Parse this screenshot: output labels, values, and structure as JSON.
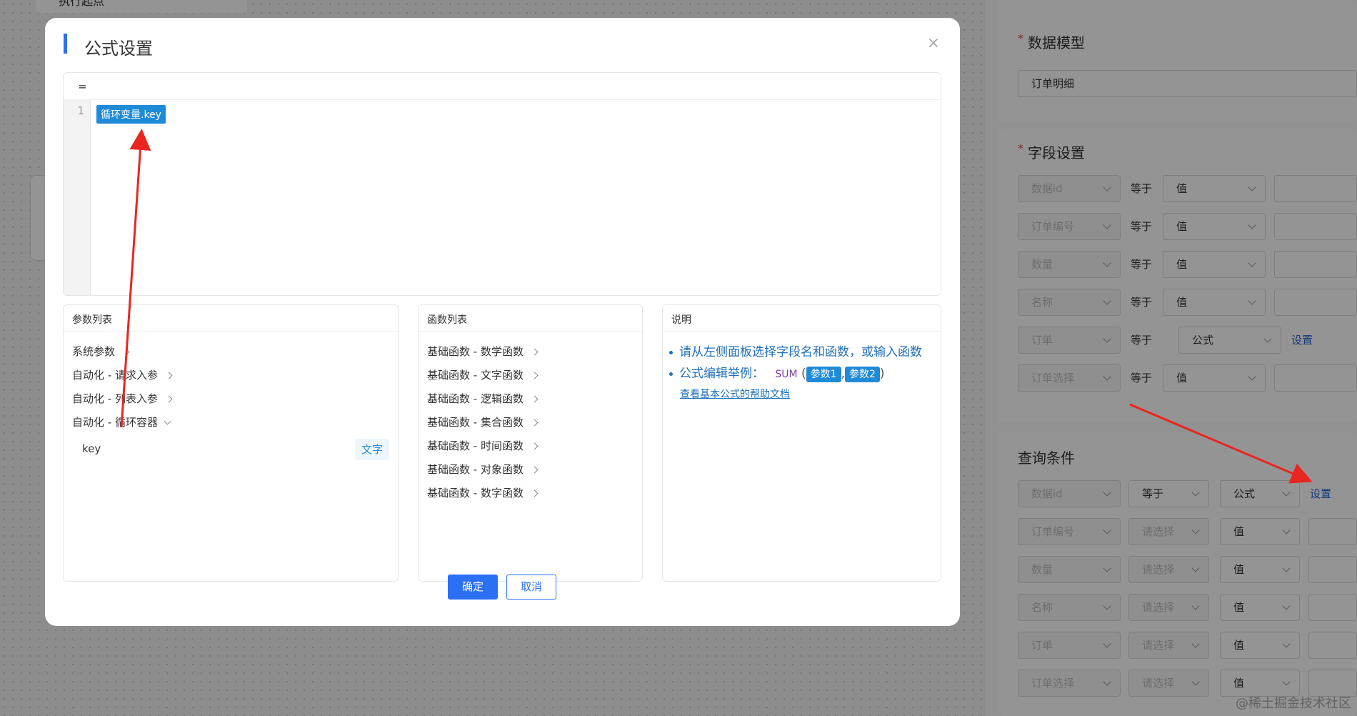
{
  "background": {
    "left_panel_label": "执行起点",
    "data_model": {
      "label": "数据模型",
      "value": "订单明细"
    },
    "field_settings": {
      "label": "字段设置",
      "rows": [
        {
          "field": "数据id",
          "op": "等于",
          "type": "值",
          "link": ""
        },
        {
          "field": "订单编号",
          "op": "等于",
          "type": "值",
          "link": ""
        },
        {
          "field": "数量",
          "op": "等于",
          "type": "值",
          "link": ""
        },
        {
          "field": "名称",
          "op": "等于",
          "type": "值",
          "link": ""
        },
        {
          "field": "订单",
          "op": "等于",
          "type": "公式",
          "link": "设置"
        },
        {
          "field": "订单选择",
          "op": "等于",
          "type": "值",
          "link": ""
        }
      ]
    },
    "query": {
      "label": "查询条件",
      "rows": [
        {
          "field": "数据id",
          "op": "等于",
          "type": "公式",
          "link": "设置"
        },
        {
          "field": "订单编号",
          "op": "请选择",
          "type": "值",
          "link": ""
        },
        {
          "field": "数量",
          "op": "请选择",
          "type": "值",
          "link": ""
        },
        {
          "field": "名称",
          "op": "请选择",
          "type": "值",
          "link": ""
        },
        {
          "field": "订单",
          "op": "请选择",
          "type": "值",
          "link": ""
        },
        {
          "field": "订单选择",
          "op": "请选择",
          "type": "值",
          "link": ""
        }
      ]
    },
    "watermark": "@稀土掘金技术社区"
  },
  "modal": {
    "title": "公式设置",
    "close_icon": "close-icon",
    "editor": {
      "prefix": "=",
      "line_number": "1",
      "token": "循环变量.key"
    },
    "params": {
      "header": "参数列表",
      "items": [
        {
          "label": "系统参数",
          "expanded": false
        },
        {
          "label": "自动化 - 请求入参",
          "expanded": false
        },
        {
          "label": "自动化 - 列表入参",
          "expanded": false
        },
        {
          "label": "自动化 - 循环容器",
          "expanded": true
        }
      ],
      "sub_item": {
        "label": "key",
        "type": "文字"
      }
    },
    "functions": {
      "header": "函数列表",
      "items": [
        "基础函数 - 数学函数",
        "基础函数 - 文字函数",
        "基础函数 - 逻辑函数",
        "基础函数 - 集合函数",
        "基础函数 - 时间函数",
        "基础函数 - 对象函数",
        "基础函数 - 数字函数"
      ]
    },
    "description": {
      "header": "说明",
      "line1": "请从左侧面板选择字段名和函数，或输入函数",
      "line2_prefix": "公式编辑举例：",
      "fn_name": "SUM",
      "paren_open": "(",
      "arg1": "参数1",
      "comma": ",",
      "arg2": "参数2",
      "paren_close": ")",
      "help_link": "查看基本公式的帮助文档"
    },
    "buttons": {
      "confirm": "确定",
      "cancel": "取消"
    }
  },
  "colors": {
    "primary": "#2b6ff5",
    "token": "#1f8ad8",
    "annotation_arrow": "#e8261f"
  }
}
